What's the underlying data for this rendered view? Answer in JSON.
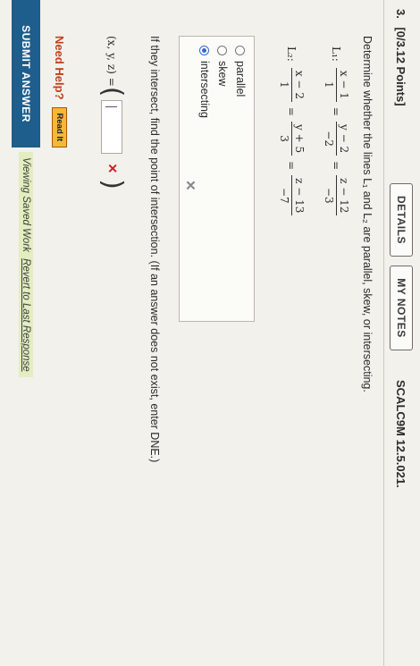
{
  "question": {
    "number": "3.",
    "points": "[0/3.12 Points]",
    "details_label": "DETAILS",
    "mynotes_label": "MY NOTES",
    "code": "SCALC9M 12.5.021."
  },
  "prompt": "Determine whether the lines L₁ and L₂ are parallel, skew, or intersecting.",
  "lines": {
    "l1": {
      "label": "L₁:",
      "fractions": [
        {
          "num": "x − 1",
          "den": "1"
        },
        {
          "num": "y − 2",
          "den": "−2"
        },
        {
          "num": "z − 12",
          "den": "−3"
        }
      ]
    },
    "l2": {
      "label": "L₂:",
      "fractions": [
        {
          "num": "x − 2",
          "den": "1"
        },
        {
          "num": "y + 5",
          "den": "3"
        },
        {
          "num": "z − 13",
          "den": "−7"
        }
      ]
    },
    "equals": "="
  },
  "options": {
    "items": [
      "parallel",
      "skew",
      "intersecting"
    ],
    "selected": "intersecting",
    "mark": "✕"
  },
  "intersect_question": "If they intersect, find the point of intersection. (If an answer does not exist, enter DNE.)",
  "answer": {
    "label": "(x, y, z) =",
    "open_paren": "(",
    "close_paren": ")",
    "value": "",
    "mark": "✕"
  },
  "help": {
    "label": "Need Help?",
    "read_it": "Read It"
  },
  "footer": {
    "submit_label": "SUBMIT ANSWER",
    "saved_prefix": "Viewing Saved Work",
    "revert_link": "Revert to Last Response"
  },
  "colors": {
    "submit": "#1e5e8c",
    "read_it": "#f5b73a",
    "need_help": "#c0401b",
    "error": "#d21f1f",
    "radio_selected": "#2f6ad0"
  }
}
